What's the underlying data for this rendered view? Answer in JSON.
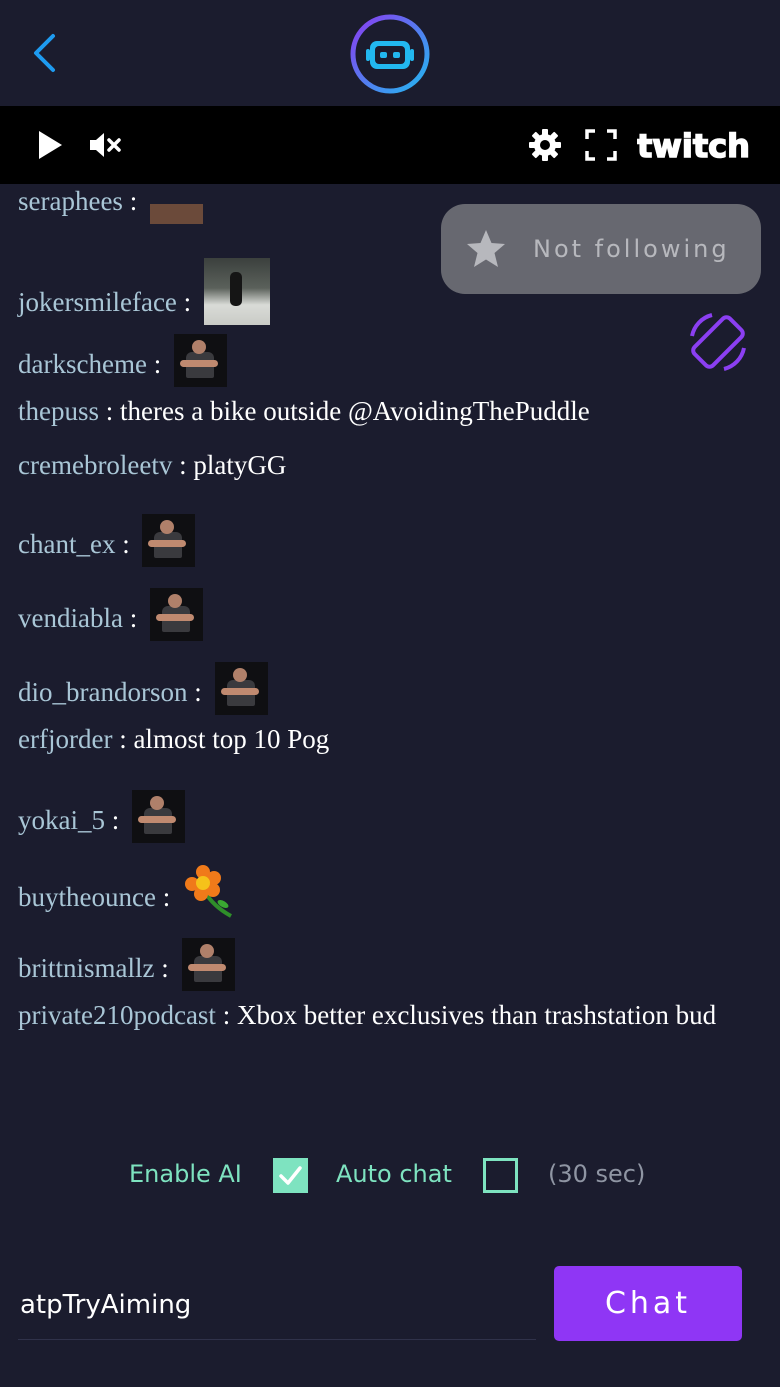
{
  "header": {
    "back_icon": "chevron-left-icon",
    "logo_icon": "robot-logo-icon",
    "accent": "#1e9bf0"
  },
  "player": {
    "play_icon": "play-icon",
    "mute_icon": "volume-muted-icon",
    "settings_icon": "gear-icon",
    "fullscreen_icon": "fullscreen-icon",
    "brand": "twitch"
  },
  "overlay": {
    "follow_label": "Not following",
    "star_icon": "star-icon",
    "rotate_icon": "screen-rotate-icon"
  },
  "messages": [
    {
      "user": "seraphees",
      "sep": " : ",
      "text": "",
      "emote": "emote-clip"
    },
    {
      "user": "jokersmileface",
      "sep": " : ",
      "text": "",
      "emote": "emote-photo"
    },
    {
      "user": "darkscheme",
      "sep": " : ",
      "text": "",
      "emote": "emote-man"
    },
    {
      "user": "thepuss",
      "sep": " : ",
      "text": "theres a bike outside @AvoidingThePuddle",
      "emote": ""
    },
    {
      "user": "cremebroleetv",
      "sep": " : ",
      "text": "platyGG",
      "emote": ""
    },
    {
      "user": "chant_ex",
      "sep": " : ",
      "text": "",
      "emote": "emote-man"
    },
    {
      "user": "vendiabla",
      "sep": " : ",
      "text": "",
      "emote": "emote-man"
    },
    {
      "user": "dio_brandorson",
      "sep": " : ",
      "text": "",
      "emote": "emote-man"
    },
    {
      "user": "erfjorder",
      "sep": " : ",
      "text": "almost top 10 Pog",
      "emote": ""
    },
    {
      "user": "yokai_5",
      "sep": " : ",
      "text": "",
      "emote": "emote-man"
    },
    {
      "user": "buytheounce",
      "sep": " : ",
      "text": "",
      "emote": "emote-flower"
    },
    {
      "user": "brittnismallz",
      "sep": " : ",
      "text": "",
      "emote": "emote-man"
    },
    {
      "user": "private210podcast",
      "sep": " : ",
      "text": "Xbox better exclusives than trashstation bud",
      "emote": ""
    }
  ],
  "options": {
    "enable_ai_label": "Enable AI",
    "enable_ai_checked": true,
    "auto_chat_label": "Auto chat",
    "auto_chat_checked": false,
    "interval_hint": "(30 sec)"
  },
  "composer": {
    "input_value": "atpTryAiming",
    "send_label": "Chat",
    "button_color": "#8f36f5"
  }
}
